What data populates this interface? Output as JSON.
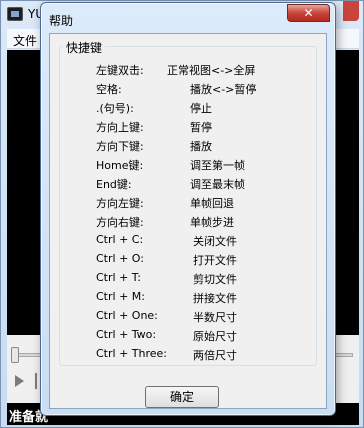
{
  "background_window": {
    "title": "YU",
    "menu": [
      "文件"
    ],
    "status_text": "准备就"
  },
  "dialog": {
    "title": "帮助",
    "close_label": "✕",
    "group_title": "快捷键",
    "shortcuts": [
      {
        "key": "左键双击:",
        "action": "正常视图<->全屏"
      },
      {
        "key": "空格:",
        "action": "播放<->暂停"
      },
      {
        "key": ".(句号):",
        "action": "停止"
      },
      {
        "key": "方向上键:",
        "action": "暂停"
      },
      {
        "key": "方向下键:",
        "action": "播放"
      },
      {
        "key": "Home键:",
        "action": "调至第一帧"
      },
      {
        "key": "End键:",
        "action": "调至最末帧"
      },
      {
        "key": "方向左键:",
        "action": "单帧回退"
      },
      {
        "key": "方向右键:",
        "action": "单帧步进"
      },
      {
        "key": "Ctrl + C:",
        "action": "关闭文件"
      },
      {
        "key": "Ctrl + O:",
        "action": "打开文件"
      },
      {
        "key": "Ctrl + T:",
        "action": "剪切文件"
      },
      {
        "key": "Ctrl + M:",
        "action": "拼接文件"
      },
      {
        "key": "Ctrl + One:",
        "action": "半数尺寸"
      },
      {
        "key": "Ctrl + Two:",
        "action": "原始尺寸"
      },
      {
        "key": "Ctrl + Three:",
        "action": "两倍尺寸"
      }
    ],
    "ok_label": "确定"
  }
}
